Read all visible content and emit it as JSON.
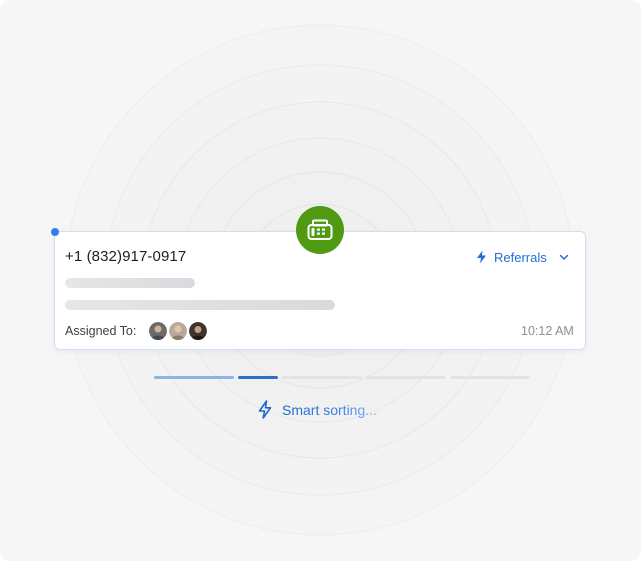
{
  "card": {
    "phone": "+1 (832)917-0917",
    "category_label": "Referrals",
    "assigned_label": "Assigned To:",
    "time": "10:12 AM",
    "avatars": [
      "avatar-1",
      "avatar-2",
      "avatar-3"
    ]
  },
  "progress": {
    "segments": [
      {
        "state": "complete",
        "fill": 1.0
      },
      {
        "state": "active",
        "fill": 1.0
      },
      {
        "state": "pending",
        "fill": 0.0
      },
      {
        "state": "pending",
        "fill": 0.0
      },
      {
        "state": "pending",
        "fill": 0.0
      }
    ]
  },
  "status": {
    "text": "Smart sorting..."
  },
  "icons": {
    "fax": "fax-icon",
    "category": "lightning-icon",
    "dropdown": "chevron-down-icon",
    "status": "lightning-icon"
  },
  "colors": {
    "accent": "#1f6fd6",
    "badge": "#4f9a12",
    "card_border": "#cfe0f6",
    "background": "#f6f6f7"
  }
}
